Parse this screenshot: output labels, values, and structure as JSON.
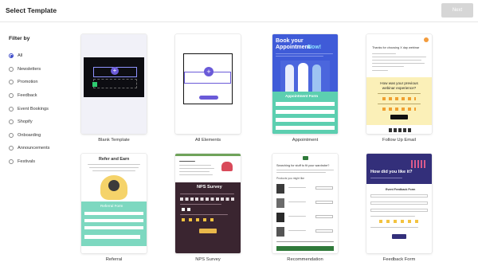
{
  "header": {
    "title": "Select Template",
    "next_label": "Next"
  },
  "filter": {
    "title": "Filter by",
    "selected": "All",
    "options": [
      "All",
      "Newsletters",
      "Promotion",
      "Feedback",
      "Event Bookings",
      "Shopify",
      "Onboarding",
      "Announcements",
      "Festivals"
    ]
  },
  "templates": [
    {
      "name": "Blank Template"
    },
    {
      "name": "All Elements"
    },
    {
      "name": "Appointment"
    },
    {
      "name": "Follow Up Email"
    },
    {
      "name": "Referral"
    },
    {
      "name": "NPS Survey"
    },
    {
      "name": "Recommendation"
    },
    {
      "name": "Feedback Form"
    }
  ],
  "previews": {
    "appointment_heading_1": "Book your",
    "appointment_heading_2": "Appointment",
    "appointment_heading_3": "Now!",
    "appointment_form": "Appointment Form",
    "followup_heading": "Thanks for choosing X day webinar",
    "followup_question": "How was your previous webinar experience?",
    "referral_heading": "Refer and Earn",
    "referral_form": "Referral Form",
    "nps_title": "NPS Survey",
    "recommendation_heading": "Searching for stuff to fit your wardrobe?",
    "recommendation_sub": "Products you might like",
    "feedback_heading": "How did you like it?",
    "feedback_form": "Event Feedback Form"
  },
  "colors": {
    "accent": "#3b49c9",
    "teal": "#5ccfb0",
    "appointment_blue": "#3f5bd8",
    "followup_yellow": "#fbf0b8",
    "referral_teal": "#7dd8c0",
    "nps_dark": "#3a2530",
    "feedback_purple": "#332f7a",
    "next_disabled": "#d6d6d6"
  },
  "icons": {
    "radio_selected": "radio-checked-icon",
    "plus": "plus-circle-icon",
    "basket": "basket-icon"
  }
}
